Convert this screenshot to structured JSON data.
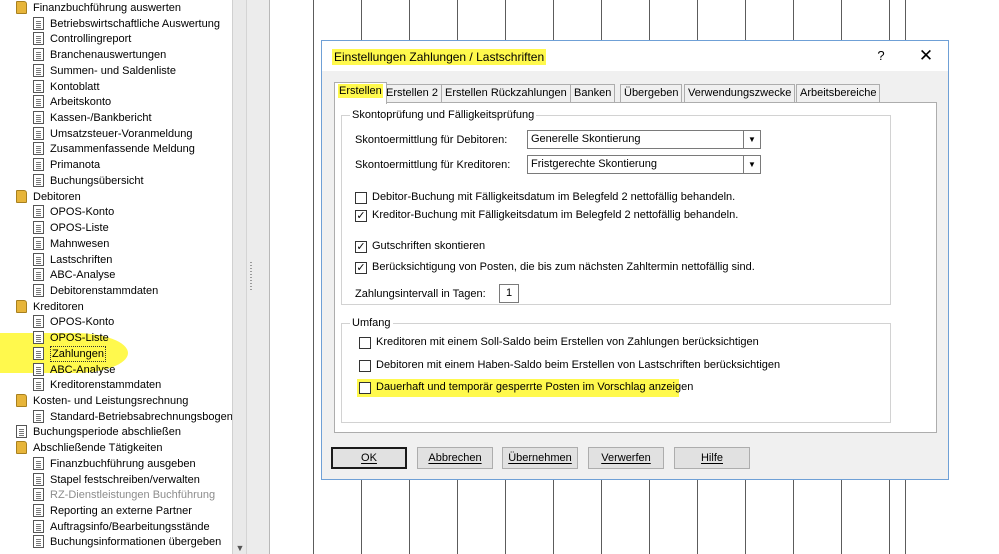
{
  "tree": {
    "items": [
      {
        "label": "Finanzbuchführung auswerten",
        "type": "folder",
        "level": 0
      },
      {
        "label": "Betriebswirtschaftliche Auswertung",
        "type": "doc",
        "level": 1
      },
      {
        "label": "Controllingreport",
        "type": "doc",
        "level": 1
      },
      {
        "label": "Branchenauswertungen",
        "type": "doc",
        "level": 1
      },
      {
        "label": "Summen- und Saldenliste",
        "type": "doc",
        "level": 1
      },
      {
        "label": "Kontoblatt",
        "type": "doc",
        "level": 1
      },
      {
        "label": "Arbeitskonto",
        "type": "doc",
        "level": 1
      },
      {
        "label": "Kassen-/Bankbericht",
        "type": "doc",
        "level": 1
      },
      {
        "label": "Umsatzsteuer-Voranmeldung",
        "type": "doc",
        "level": 1
      },
      {
        "label": "Zusammenfassende Meldung",
        "type": "doc",
        "level": 1
      },
      {
        "label": "Primanota",
        "type": "doc",
        "level": 1
      },
      {
        "label": "Buchungsübersicht",
        "type": "doc",
        "level": 1
      },
      {
        "label": "Debitoren",
        "type": "folder",
        "level": 0
      },
      {
        "label": "OPOS-Konto",
        "type": "doc",
        "level": 1
      },
      {
        "label": "OPOS-Liste",
        "type": "doc",
        "level": 1
      },
      {
        "label": "Mahnwesen",
        "type": "doc",
        "level": 1
      },
      {
        "label": "Lastschriften",
        "type": "doc",
        "level": 1
      },
      {
        "label": "ABC-Analyse",
        "type": "doc",
        "level": 1
      },
      {
        "label": "Debitorenstammdaten",
        "type": "doc",
        "level": 1
      },
      {
        "label": "Kreditoren",
        "type": "folder",
        "level": 0
      },
      {
        "label": "OPOS-Konto",
        "type": "doc",
        "level": 1
      },
      {
        "label": "OPOS-Liste",
        "type": "doc",
        "level": 1
      },
      {
        "label": "Zahlungen",
        "type": "doc",
        "level": 1,
        "selected": true
      },
      {
        "label": "ABC-Analyse",
        "type": "doc",
        "level": 1
      },
      {
        "label": "Kreditorenstammdaten",
        "type": "doc",
        "level": 1
      },
      {
        "label": "Kosten- und Leistungsrechnung",
        "type": "folder",
        "level": 0
      },
      {
        "label": "Standard-Betriebsabrechnungsbogen",
        "type": "doc",
        "level": 1
      },
      {
        "label": "Buchungsperiode abschließen",
        "type": "doc",
        "level": 0
      },
      {
        "label": "Abschließende Tätigkeiten",
        "type": "folder",
        "level": 0
      },
      {
        "label": "Finanzbuchführung ausgeben",
        "type": "doc",
        "level": 1
      },
      {
        "label": "Stapel festschreiben/verwalten",
        "type": "doc",
        "level": 1
      },
      {
        "label": "RZ-Dienstleistungen Buchführung",
        "type": "doc",
        "level": 1,
        "disabled": true
      },
      {
        "label": "Reporting an externe Partner",
        "type": "doc",
        "level": 1
      },
      {
        "label": "Auftragsinfo/Bearbeitungsstände",
        "type": "doc",
        "level": 1
      },
      {
        "label": "Buchungsinformationen übergeben",
        "type": "doc",
        "level": 1
      }
    ]
  },
  "dialog": {
    "title": "Einstellungen Zahlungen / Lastschriften",
    "help": "?",
    "close": "✕",
    "tabs": [
      "Erstellen",
      "Erstellen 2",
      "Erstellen Rückzahlungen",
      "Banken",
      "Übergeben",
      "Verwendungszwecke",
      "Arbeitsbereiche"
    ],
    "active_tab": 0,
    "group1": {
      "legend": "Skontoprüfung und Fälligkeitsprüfung",
      "debitor_label": "Skontoermittlung für Debitoren:",
      "debitor_value": "Generelle Skontierung",
      "kreditor_label": "Skontoermittlung für Kreditoren:",
      "kreditor_value": "Fristgerechte Skontierung",
      "checks": [
        {
          "label": "Debitor-Buchung mit Fälligkeitsdatum im Belegfeld 2 nettofällig behandeln.",
          "checked": false
        },
        {
          "label": "Kreditor-Buchung mit Fälligkeitsdatum im Belegfeld 2 nettofällig behandeln.",
          "checked": true
        },
        {
          "label": "Gutschriften skontieren",
          "checked": true
        },
        {
          "label": "Berücksichtigung von Posten, die bis zum nächsten Zahltermin nettofällig sind.",
          "checked": true
        }
      ],
      "interval_label": "Zahlungsintervall in Tagen:",
      "interval_value": "1"
    },
    "group2": {
      "legend": "Umfang",
      "checks": [
        {
          "label": "Kreditoren mit einem Soll-Saldo beim Erstellen von Zahlungen berücksichtigen",
          "checked": false
        },
        {
          "label": "Debitoren mit einem Haben-Saldo beim Erstellen von Lastschriften berücksichtigen",
          "checked": false
        },
        {
          "label": "Dauerhaft und temporär gesperrte Posten im Vorschlag anzeigen",
          "checked": false
        }
      ]
    },
    "buttons": [
      "OK",
      "Abbrechen",
      "Übernehmen",
      "Verwerfen",
      "Hilfe"
    ]
  },
  "grid": {
    "columns": [
      313,
      361,
      409,
      457,
      505,
      553,
      601,
      649,
      697,
      745,
      793,
      841,
      889,
      905
    ]
  },
  "colors": {
    "highlight": "#fff94d",
    "folder": "#e7b53a",
    "dialog_border": "#6fa0d6"
  }
}
